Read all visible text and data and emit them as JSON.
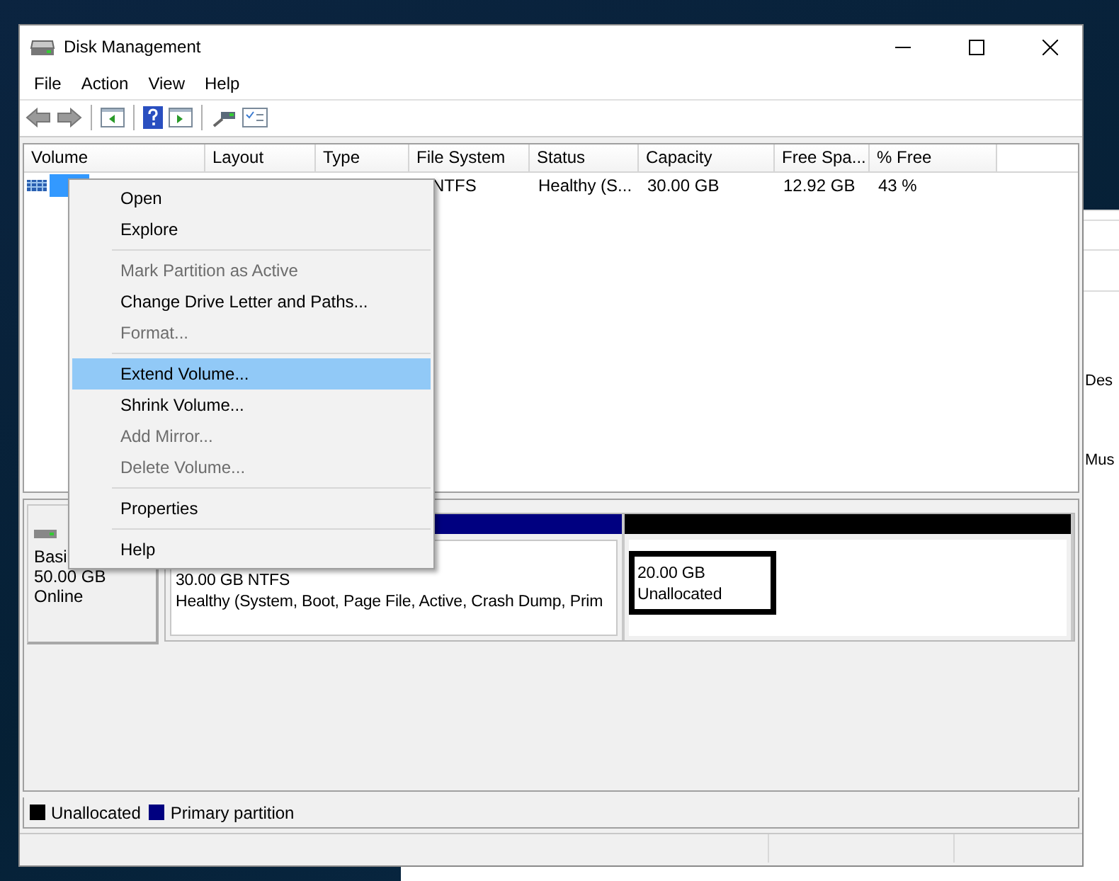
{
  "window": {
    "title": "Disk Management"
  },
  "menu_bar": [
    "File",
    "Action",
    "View",
    "Help"
  ],
  "table": {
    "columns": [
      "Volume",
      "Layout",
      "Type",
      "File System",
      "Status",
      "Capacity",
      "Free Spa...",
      "% Free"
    ],
    "rows": [
      {
        "selected": true,
        "file_system": "NTFS",
        "status": "Healthy (S...",
        "capacity": "30.00 GB",
        "free_space": "12.92 GB",
        "percent_free": "43 %"
      }
    ]
  },
  "context_menu": {
    "items": [
      {
        "kind": "item",
        "label": "Open",
        "disabled": false,
        "selected": false
      },
      {
        "kind": "item",
        "label": "Explore",
        "disabled": false,
        "selected": false
      },
      {
        "kind": "separator"
      },
      {
        "kind": "item",
        "label": "Mark Partition as Active",
        "disabled": true,
        "selected": false
      },
      {
        "kind": "item",
        "label": "Change Drive Letter and Paths...",
        "disabled": false,
        "selected": false
      },
      {
        "kind": "item",
        "label": "Format...",
        "disabled": true,
        "selected": false
      },
      {
        "kind": "separator"
      },
      {
        "kind": "item",
        "label": "Extend Volume...",
        "disabled": false,
        "selected": true
      },
      {
        "kind": "item",
        "label": "Shrink Volume...",
        "disabled": false,
        "selected": false
      },
      {
        "kind": "item",
        "label": "Add Mirror...",
        "disabled": true,
        "selected": false
      },
      {
        "kind": "item",
        "label": "Delete Volume...",
        "disabled": true,
        "selected": false
      },
      {
        "kind": "separator"
      },
      {
        "kind": "item",
        "label": "Properties",
        "disabled": false,
        "selected": false
      },
      {
        "kind": "separator"
      },
      {
        "kind": "item",
        "label": "Help",
        "disabled": false,
        "selected": false
      }
    ]
  },
  "disk": {
    "type": "Basi",
    "size": "50.00 GB",
    "status": "Online",
    "partitions": [
      {
        "color": "#000080",
        "selected": false,
        "size": "30.00 GB NTFS",
        "status": "Healthy (System, Boot, Page File, Active, Crash Dump, Prim"
      },
      {
        "color": "#000000",
        "selected": true,
        "size": "20.00 GB",
        "status": "Unallocated"
      }
    ]
  },
  "legend": [
    {
      "color": "#000000",
      "label": "Unallocated"
    },
    {
      "color": "#000080",
      "label": "Primary partition"
    }
  ],
  "side_panel": {
    "texts": [
      "Des",
      "Mus"
    ]
  }
}
